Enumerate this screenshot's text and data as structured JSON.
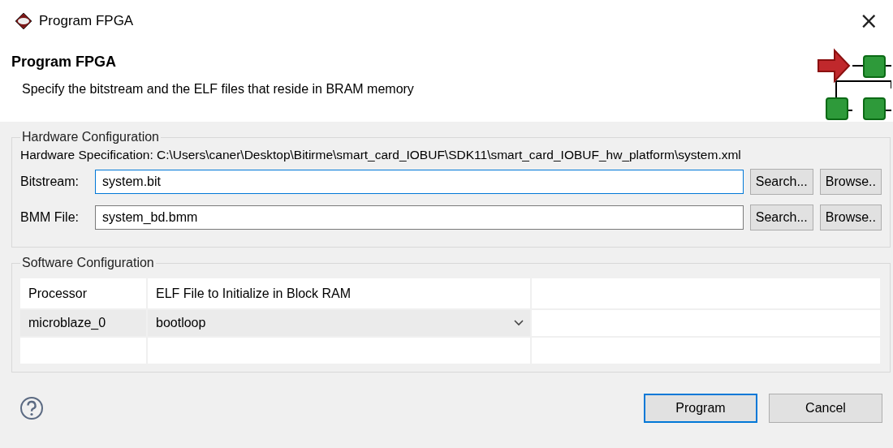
{
  "window": {
    "title": "Program FPGA",
    "close": "×"
  },
  "header": {
    "title": "Program FPGA",
    "description": "Specify the bitstream and the ELF files that reside in BRAM memory"
  },
  "hardware": {
    "legend": "Hardware Configuration",
    "specification": "Hardware Specification: C:\\Users\\caner\\Desktop\\Bitirme\\smart_card_IOBUF\\SDK11\\smart_card_IOBUF_hw_platform\\system.xml",
    "fields": [
      {
        "label": "Bitstream:",
        "value": "system.bit",
        "focused": true,
        "search": "Search...",
        "browse": "Browse.."
      },
      {
        "label": "BMM File:",
        "value": "system_bd.bmm",
        "focused": false,
        "search": "Search...",
        "browse": "Browse.."
      }
    ]
  },
  "software": {
    "legend": "Software Configuration",
    "table": {
      "columns": [
        "Processor",
        "ELF File to Initialize in Block RAM"
      ],
      "rows": [
        {
          "processor": "microblaze_0",
          "elf": "bootloop",
          "selected": true
        }
      ]
    }
  },
  "buttons": [
    {
      "label": "Program",
      "default": true
    },
    {
      "label": "Cancel",
      "default": false
    }
  ]
}
